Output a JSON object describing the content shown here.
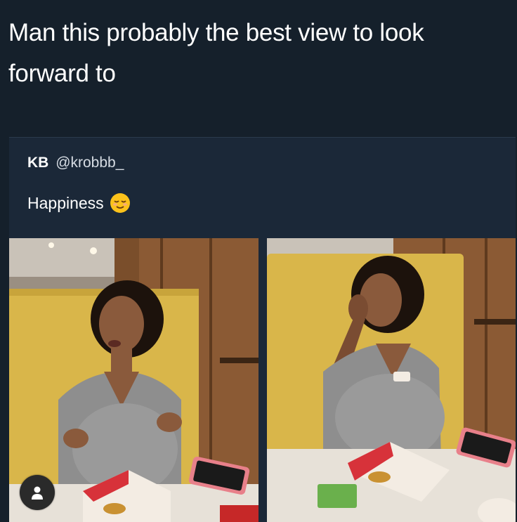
{
  "post": {
    "caption_line1": "Man this probably the best view to look",
    "caption_line2": "forward to"
  },
  "tweet": {
    "display_name": "KB",
    "handle": "@krobbb_",
    "text": "Happiness",
    "emoji": "relieved-face-emoji"
  },
  "photos": [
    {
      "name": "photo-left",
      "alt_subject": "woman-seated-in-booth"
    },
    {
      "name": "photo-right",
      "alt_subject": "woman-eating-in-booth"
    }
  ],
  "overlay": {
    "icon": "user-icon"
  },
  "colors": {
    "background": "#15202b",
    "tweet_card": "#1b2838",
    "booth_yellow": "#d9b64a",
    "wood": "#8a5a33"
  }
}
